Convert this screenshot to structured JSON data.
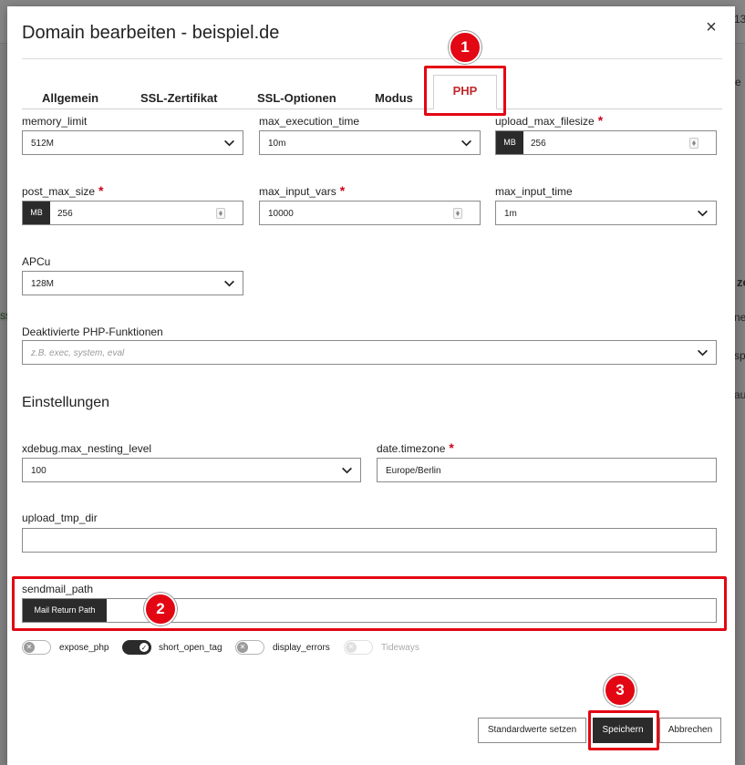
{
  "modal": {
    "title": "Domain bearbeiten - beispiel.de",
    "close_symbol": "×"
  },
  "tabs": [
    {
      "label": "Allgemein"
    },
    {
      "label": "SSL-Zertifikat"
    },
    {
      "label": "SSL-Optionen"
    },
    {
      "label": "Modus"
    },
    {
      "label": "PHP",
      "active": true
    }
  ],
  "fields": {
    "memory_limit": {
      "label": "memory_limit",
      "value": "512M"
    },
    "max_execution_time": {
      "label": "max_execution_time",
      "value": "10m"
    },
    "upload_max_filesize": {
      "label": "upload_max_filesize",
      "required": "*",
      "unit": "MB",
      "value": "256"
    },
    "post_max_size": {
      "label": "post_max_size",
      "required": "*",
      "unit": "MB",
      "value": "256"
    },
    "max_input_vars": {
      "label": "max_input_vars",
      "required": "*",
      "value": "10000"
    },
    "max_input_time": {
      "label": "max_input_time",
      "value": "1m"
    },
    "apcu": {
      "label": "APCu",
      "value": "128M"
    },
    "disabled_functions": {
      "label": "Deaktivierte PHP-Funktionen",
      "placeholder": "z.B. exec, system, eval"
    }
  },
  "settings": {
    "title": "Einstellungen",
    "xdebug": {
      "label": "xdebug.max_nesting_level",
      "value": "100"
    },
    "timezone": {
      "label": "date.timezone",
      "required": "*",
      "value": "Europe/Berlin"
    },
    "upload_tmp_dir": {
      "label": "upload_tmp_dir",
      "value": ""
    },
    "sendmail_path": {
      "label": "sendmail_path",
      "tag": "Mail Return Path",
      "value": ""
    }
  },
  "toggles": {
    "expose_php": {
      "label": "expose_php",
      "state": "off"
    },
    "short_open_tag": {
      "label": "short_open_tag",
      "state": "on"
    },
    "display_errors": {
      "label": "display_errors",
      "state": "off"
    },
    "tideways": {
      "label": "Tideways",
      "state": "disabled"
    }
  },
  "buttons": {
    "defaults": "Standardwerte setzen",
    "save": "Speichern",
    "cancel": "Abbrechen"
  },
  "annotations": [
    "1",
    "2",
    "3"
  ],
  "background_fragments": [
    "13",
    "e B",
    "ze",
    "ne",
    "sp",
    "au",
    "SSI"
  ],
  "colors": {
    "accent_red": "#c0292b",
    "highlight": "#e30613",
    "dark": "#2b2b2b"
  }
}
